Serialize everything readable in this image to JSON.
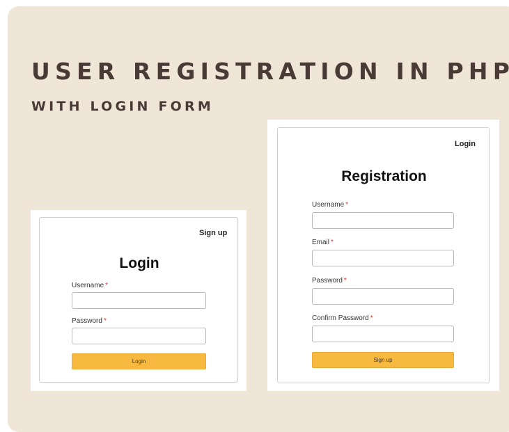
{
  "banner": {
    "title": "USER REGISTRATION IN PHP",
    "subtitle": "WITH LOGIN FORM"
  },
  "login_card": {
    "corner_link": "Sign up",
    "title": "Login",
    "username_label": "Username",
    "password_label": "Password",
    "required_mark": "*",
    "submit_label": "Login"
  },
  "registration_card": {
    "corner_link": "Login",
    "title": "Registration",
    "username_label": "Username",
    "email_label": "Email",
    "password_label": "Password",
    "confirm_password_label": "Confirm Password",
    "required_mark": "*",
    "submit_label": "Sign up"
  },
  "colors": {
    "background": "#efe6d8",
    "title_text": "#4a3a36",
    "button": "#f8b941",
    "required": "#d9382f"
  }
}
